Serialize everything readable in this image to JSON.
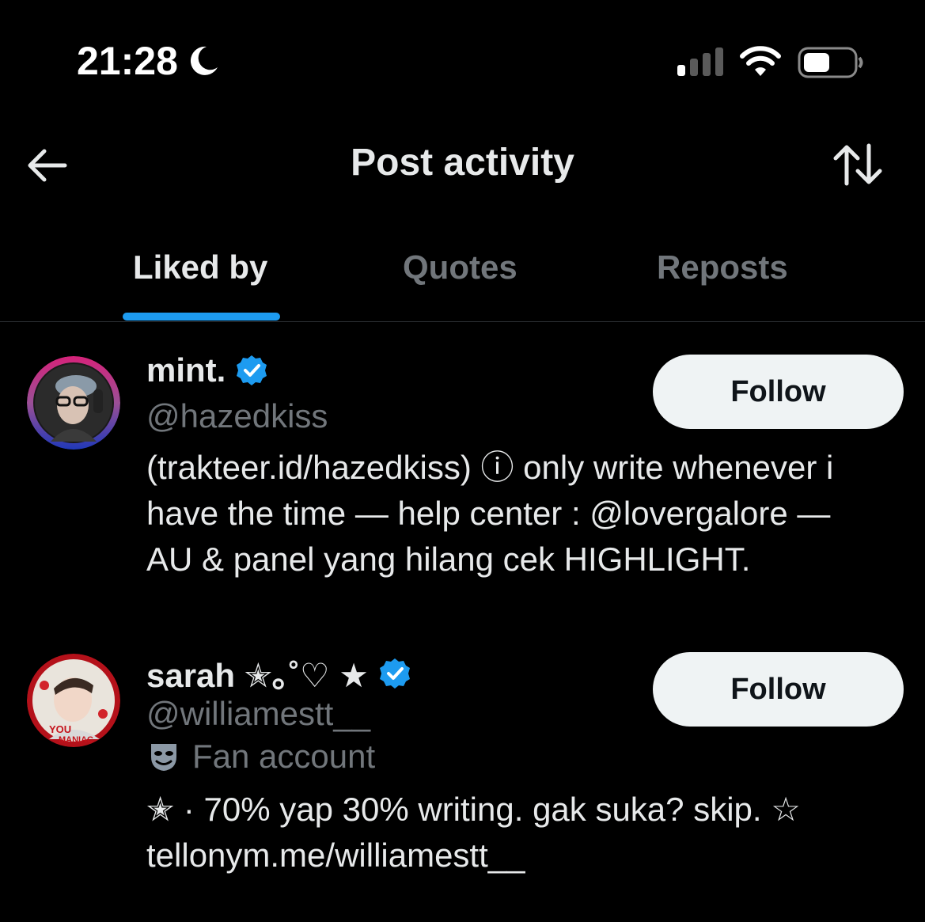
{
  "status_bar": {
    "time": "21:28"
  },
  "header": {
    "title": "Post activity"
  },
  "tabs": [
    {
      "label": "Liked by",
      "active": true
    },
    {
      "label": "Quotes",
      "active": false
    },
    {
      "label": "Reposts",
      "active": false
    }
  ],
  "users": [
    {
      "display_name": "mint.",
      "verified": true,
      "handle": "@hazedkiss",
      "follow_label": "Follow",
      "bio_lines": [
        "(trakteer.id/hazedkiss) ⓘ only write whenever i",
        "have the time — help center : @lovergalore —",
        "AU & panel yang hilang cek HIGHLIGHT."
      ]
    },
    {
      "display_name": "sarah ✭｡˚♡ ★",
      "verified": true,
      "handle": "@williamestt__",
      "category": "Fan account",
      "follow_label": "Follow",
      "bio_lines": [
        "✭ · 70% yap 30% writing. gak suka? skip. ☆",
        "tellonym.me/williamestt__"
      ]
    }
  ],
  "colors": {
    "background": "#000000",
    "primary_text": "#e7e9ea",
    "secondary_text": "#71767b",
    "accent": "#1d9bf0",
    "follow_button_bg": "#eff3f4"
  },
  "icons": [
    "moon-icon",
    "signal-icon",
    "wifi-icon",
    "battery-icon",
    "back-arrow-icon",
    "sort-icon",
    "verified-icon",
    "mask-icon"
  ]
}
